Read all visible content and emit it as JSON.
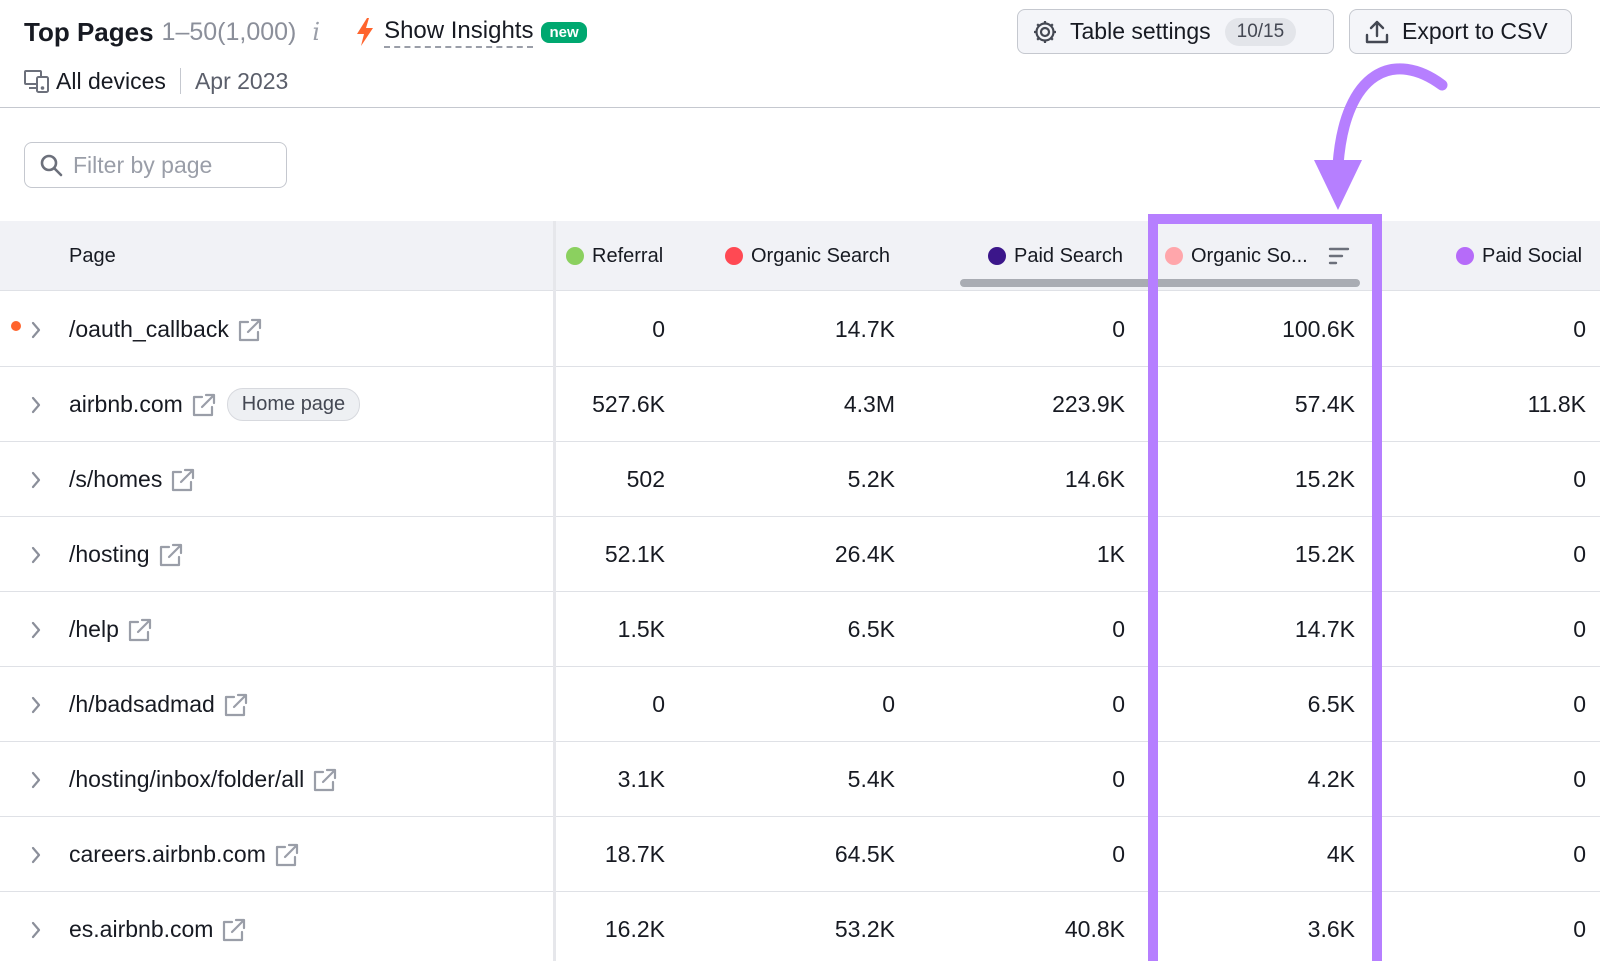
{
  "header": {
    "title": "Top Pages",
    "range": "1–50(1,000)",
    "insights_label": "Show Insights",
    "new_badge": "new",
    "devices": "All devices",
    "month": "Apr 2023"
  },
  "toolbar": {
    "settings_label": "Table settings",
    "settings_count": "10/15",
    "export_label": "Export to CSV"
  },
  "filter": {
    "placeholder": "Filter by page"
  },
  "columns": {
    "page": "Page",
    "referral": "Referral",
    "organic_search": "Organic Search",
    "paid_search": "Paid Search",
    "organic_social": "Organic So...",
    "paid_social": "Paid Social"
  },
  "colors": {
    "referral": "#8bd05f",
    "organic_search": "#ff4953",
    "paid_search": "#3b168a",
    "organic_social": "#ffa6ab",
    "paid_social": "#b66bf9",
    "highlight": "#b67fff",
    "new_badge": "#00a870"
  },
  "rows": [
    {
      "page": "/oauth_callback",
      "badge": "",
      "referral": "0",
      "organic_search": "14.7K",
      "paid_search": "0",
      "organic_social": "100.6K",
      "paid_social": "0"
    },
    {
      "page": "airbnb.com",
      "badge": "Home page",
      "referral": "527.6K",
      "organic_search": "4.3M",
      "paid_search": "223.9K",
      "organic_social": "57.4K",
      "paid_social": "11.8K"
    },
    {
      "page": "/s/homes",
      "badge": "",
      "referral": "502",
      "organic_search": "5.2K",
      "paid_search": "14.6K",
      "organic_social": "15.2K",
      "paid_social": "0"
    },
    {
      "page": "/hosting",
      "badge": "",
      "referral": "52.1K",
      "organic_search": "26.4K",
      "paid_search": "1K",
      "organic_social": "15.2K",
      "paid_social": "0"
    },
    {
      "page": "/help",
      "badge": "",
      "referral": "1.5K",
      "organic_search": "6.5K",
      "paid_search": "0",
      "organic_social": "14.7K",
      "paid_social": "0"
    },
    {
      "page": "/h/badsadmad",
      "badge": "",
      "referral": "0",
      "organic_search": "0",
      "paid_search": "0",
      "organic_social": "6.5K",
      "paid_social": "0"
    },
    {
      "page": "/hosting/inbox/folder/all",
      "badge": "",
      "referral": "3.1K",
      "organic_search": "5.4K",
      "paid_search": "0",
      "organic_social": "4.2K",
      "paid_social": "0"
    },
    {
      "page": "careers.airbnb.com",
      "badge": "",
      "referral": "18.7K",
      "organic_search": "64.5K",
      "paid_search": "0",
      "organic_social": "4K",
      "paid_social": "0"
    },
    {
      "page": "es.airbnb.com",
      "badge": "",
      "referral": "16.2K",
      "organic_search": "53.2K",
      "paid_search": "40.8K",
      "organic_social": "3.6K",
      "paid_social": "0"
    }
  ]
}
